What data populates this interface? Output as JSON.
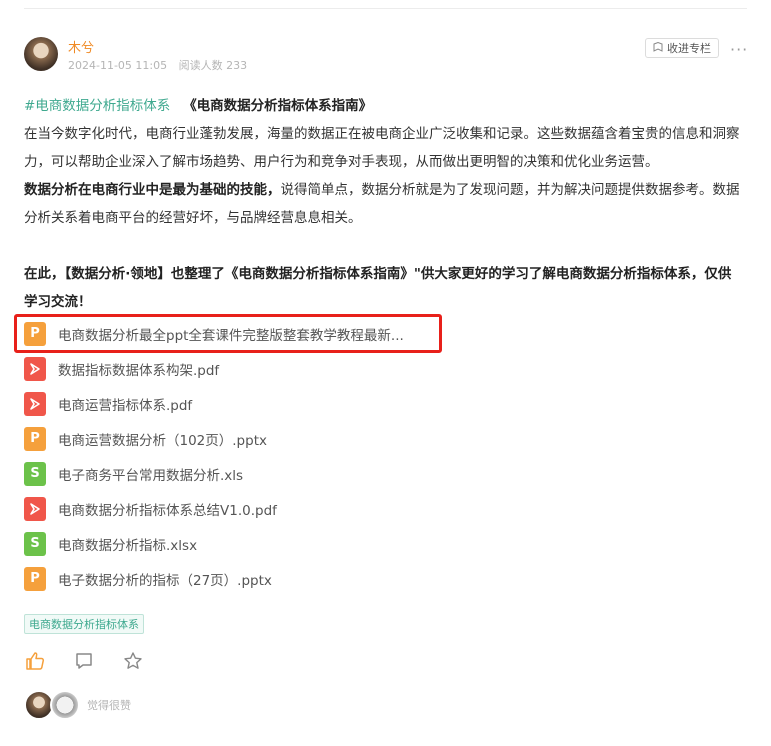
{
  "post": {
    "author": "木兮",
    "date": "2024-11-05 11:05",
    "readers": "阅读人数 233",
    "follow_label": "收进专栏",
    "more_label": "···"
  },
  "content": {
    "hashtag": "#电商数据分析指标体系",
    "title_book": "《电商数据分析指标体系指南》",
    "para1": "在当今数字化时代，电商行业蓬勃发展，海量的数据正在被电商企业广泛收集和记录。这些数据蕴含着宝贵的信息和洞察力，可以帮助企业深入了解市场趋势、用户行为和竞争对手表现，从而做出更明智的决策和优化业务运营。",
    "para2_bold": "数据分析在电商行业中是最为基础的技能，",
    "para2_rest": "说得简单点，数据分析就是为了发现问题，并为解决问题提供数据参考。数据分析关系着电商平台的经营好坏，与品牌经营息息相关。",
    "para3": "在此，【数据分析·领地】也整理了《电商数据分析指标体系指南》\"供大家更好的学习了解电商数据分析指标体系，仅供学习交流！"
  },
  "files": [
    {
      "name": "电商数据分析最全ppt全套课件完整版整套教学教程最新...",
      "type": "ppt",
      "icon": "ppt-file-icon",
      "glyph": "P"
    },
    {
      "name": "数据指标数据体系构架.pdf",
      "type": "pdf",
      "icon": "pdf-file-icon",
      "glyph": ""
    },
    {
      "name": "电商运营指标体系.pdf",
      "type": "pdf",
      "icon": "pdf-file-icon",
      "glyph": ""
    },
    {
      "name": "电商运营数据分析（102页）.pptx",
      "type": "ppt",
      "icon": "ppt-file-icon",
      "glyph": "P"
    },
    {
      "name": "电子商务平台常用数据分析.xls",
      "type": "xls",
      "icon": "xls-file-icon",
      "glyph": "S"
    },
    {
      "name": "电商数据分析指标体系总结V1.0.pdf",
      "type": "pdf",
      "icon": "pdf-file-icon",
      "glyph": ""
    },
    {
      "name": "电商数据分析指标.xlsx",
      "type": "xls",
      "icon": "xls-file-icon",
      "glyph": "S"
    },
    {
      "name": "电子数据分析的指标（27页）.pptx",
      "type": "ppt",
      "icon": "ppt-file-icon",
      "glyph": "P"
    }
  ],
  "topic_tag": "电商数据分析指标体系",
  "likers_text": "觉得很赞",
  "colors": {
    "accent_orange": "#f08a24",
    "tag_green": "#3fa98f",
    "highlight_red": "#e8201a",
    "like_orange": "#f5a03c"
  }
}
